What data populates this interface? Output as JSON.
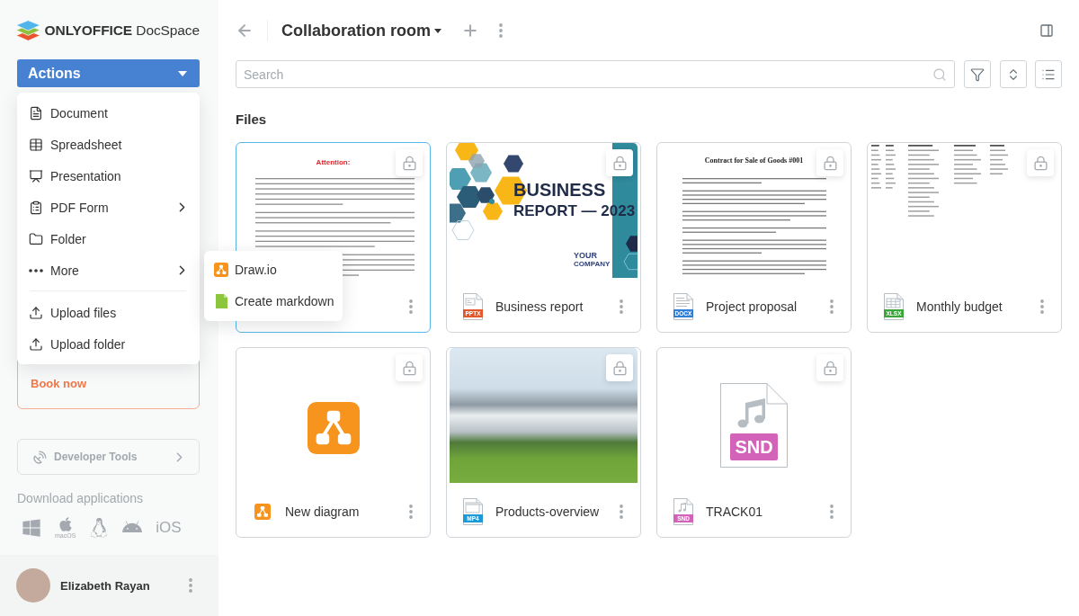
{
  "sidebar": {
    "logo": {
      "text": "**ONLYOFFICE** DocSpace"
    },
    "actions_button": {
      "label": "Actions",
      "expanded": true
    },
    "actions_menu": {
      "groups": [
        {
          "items": [
            {
              "kind": "document",
              "label": "Document",
              "has_submenu": false
            },
            {
              "kind": "spreadsheet",
              "label": "Spreadsheet",
              "has_submenu": false
            },
            {
              "kind": "presentation",
              "label": "Presentation",
              "has_submenu": false
            },
            {
              "kind": "pdf_form",
              "label": "PDF Form",
              "has_submenu": true
            },
            {
              "kind": "folder",
              "label": "Folder",
              "has_submenu": false
            },
            {
              "kind": "more",
              "label": "More",
              "has_submenu": true,
              "submenu": [
                {
                  "kind": "diagram",
                  "label": "Draw.io"
                },
                {
                  "kind": "markdown",
                  "label": "Create markdown"
                }
              ]
            }
          ]
        },
        {
          "items": [
            {
              "kind": "upload",
              "label": "Upload files",
              "has_submenu": false
            },
            {
              "kind": "upload",
              "label": "Upload folder",
              "has_submenu": false
            }
          ]
        }
      ]
    },
    "promo": {
      "link": "Book now"
    },
    "developer_tools": {
      "label": "Developer Tools"
    },
    "downloads": {
      "title": "Download applications",
      "apps": [
        {
          "kind": "windows"
        },
        {
          "kind": "macos",
          "label": "macOS"
        },
        {
          "kind": "linux"
        },
        {
          "kind": "android"
        },
        {
          "kind": "ios",
          "label": "iOS"
        }
      ]
    },
    "user": {
      "name": "Elizabeth Rayan"
    }
  },
  "header": {
    "title": "Collaboration room"
  },
  "search": {
    "placeholder": "Search"
  },
  "files_section": {
    "title": "Files",
    "files": [
      {
        "selected": true,
        "preview": {
          "kind": "notice",
          "heading": "Attention:"
        }
      },
      {
        "selected": false,
        "name": "Business report",
        "icon": {
          "kind": "presentation",
          "label": "PPTX",
          "color": "#e3572b"
        },
        "preview": {
          "kind": "slide",
          "title": "BUSINESS",
          "subtitle": "REPORT — 2023",
          "brand_lines": [
            "YOUR",
            "COMPANY"
          ]
        }
      },
      {
        "selected": false,
        "name": "Project proposal",
        "icon": {
          "kind": "text",
          "label": "DOCX",
          "color": "#2f7ed8"
        },
        "preview": {
          "kind": "contract",
          "heading": "Contract for Sale of Goods #001"
        }
      },
      {
        "selected": false,
        "name": "Monthly budget",
        "icon": {
          "kind": "spreadsheet",
          "label": "XLSX",
          "color": "#3aa63a"
        },
        "preview": {
          "kind": "table"
        }
      },
      {
        "selected": false,
        "name": "New diagram",
        "icon": {
          "kind": "diagram"
        },
        "preview": {
          "kind": "diagram"
        }
      },
      {
        "selected": false,
        "name": "Products-overview",
        "icon": {
          "kind": "video",
          "label": "MP4",
          "color": "#1d9ad6"
        },
        "preview": {
          "kind": "photo"
        }
      },
      {
        "selected": false,
        "name": "TRACK01",
        "icon": {
          "kind": "audio",
          "label": "SND",
          "color": "#d263b8"
        },
        "preview": {
          "kind": "audio",
          "label": "SND",
          "color": "#d263b8"
        }
      }
    ]
  }
}
